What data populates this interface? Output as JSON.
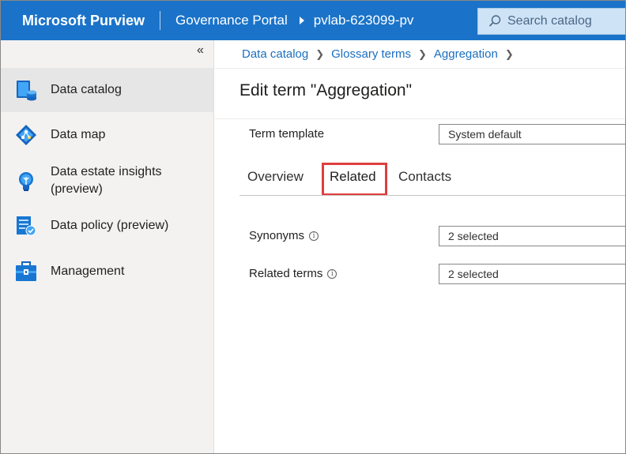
{
  "header": {
    "brand": "Microsoft Purview",
    "portal": "Governance Portal",
    "account": "pvlab-623099-pv",
    "search_placeholder": "Search catalog"
  },
  "sidebar": {
    "collapse_glyph": "«",
    "items": [
      {
        "label": "Data catalog",
        "icon": "data-catalog-icon",
        "active": true
      },
      {
        "label": "Data map",
        "icon": "data-map-icon"
      },
      {
        "label": "Data estate insights",
        "label2": "(preview)",
        "icon": "insights-icon"
      },
      {
        "label": "Data policy (preview)",
        "icon": "policy-icon"
      },
      {
        "label": "Management",
        "icon": "management-icon"
      }
    ]
  },
  "breadcrumb": [
    "Data catalog",
    "Glossary terms",
    "Aggregation"
  ],
  "page": {
    "title": "Edit term \"Aggregation\"",
    "term_template_label": "Term template",
    "term_template_value": "System default"
  },
  "tabs": [
    {
      "label": "Overview"
    },
    {
      "label": "Related",
      "active": true
    },
    {
      "label": "Contacts"
    }
  ],
  "related": {
    "synonyms_label": "Synonyms",
    "synonyms_value": "2 selected",
    "related_terms_label": "Related terms",
    "related_terms_value": "2 selected"
  },
  "colors": {
    "topbar": "#1a73c9",
    "highlight": "#e03e3e",
    "link": "#1a6fc0"
  }
}
